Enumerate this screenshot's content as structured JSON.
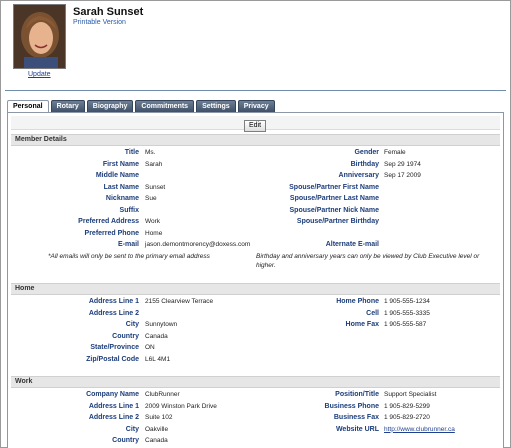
{
  "profile": {
    "name": "Sarah Sunset",
    "subtitle": "Printable Version",
    "update_label": "Update"
  },
  "tabs": [
    "Personal",
    "Rotary",
    "Biography",
    "Commitments",
    "Settings",
    "Privacy"
  ],
  "active_tab": "Personal",
  "toolbar": {
    "edit_label": "Edit"
  },
  "sections": {
    "member": "Member Details",
    "home": "Home",
    "work": "Work"
  },
  "member": {
    "left": [
      {
        "label": "Title",
        "value": "Ms."
      },
      {
        "label": "First Name",
        "value": "Sarah"
      },
      {
        "label": "Middle Name",
        "value": ""
      },
      {
        "label": "Last Name",
        "value": "Sunset"
      },
      {
        "label": "Nickname",
        "value": "Sue"
      },
      {
        "label": "Suffix",
        "value": ""
      },
      {
        "label": "Preferred Address",
        "value": "Work"
      },
      {
        "label": "Preferred Phone",
        "value": "Home"
      },
      {
        "label": "E-mail",
        "value": "jason.demontmorency@doxess.com"
      }
    ],
    "right": [
      {
        "label": "Gender",
        "value": "Female"
      },
      {
        "label": "Birthday",
        "value": "Sep 29 1974"
      },
      {
        "label": "Anniversary",
        "value": "Sep 17 2009"
      },
      {
        "label": "Spouse/Partner First Name",
        "value": ""
      },
      {
        "label": "Spouse/Partner Last Name",
        "value": ""
      },
      {
        "label": "Spouse/Partner Nick Name",
        "value": ""
      },
      {
        "label": "Spouse/Partner Birthday",
        "value": ""
      },
      {
        "label": "",
        "value": ""
      },
      {
        "label": "Alternate E-mail",
        "value": ""
      }
    ],
    "note_left": "*All emails will only be sent to the primary email address",
    "note_right": "Birthday and anniversary years can only be viewed by Club Executive level or higher."
  },
  "home": {
    "left": [
      {
        "label": "Address Line 1",
        "value": "2155 Clearview Terrace"
      },
      {
        "label": "Address Line 2",
        "value": ""
      },
      {
        "label": "City",
        "value": "Sunnytown"
      },
      {
        "label": "Country",
        "value": "Canada"
      },
      {
        "label": "State/Province",
        "value": "ON"
      },
      {
        "label": "Zip/Postal Code",
        "value": "L6L 4M1"
      }
    ],
    "right": [
      {
        "label": "Home Phone",
        "value": "1 905-555-1234"
      },
      {
        "label": "Cell",
        "value": "1 905-555-3335"
      },
      {
        "label": "Home Fax",
        "value": "1 905-555-587"
      }
    ]
  },
  "work": {
    "left": [
      {
        "label": "Company Name",
        "value": "ClubRunner"
      },
      {
        "label": "Address Line 1",
        "value": "2009 Winston Park Drive"
      },
      {
        "label": "Address Line 2",
        "value": "Suite 102"
      },
      {
        "label": "City",
        "value": "Oakville"
      },
      {
        "label": "Country",
        "value": "Canada"
      }
    ],
    "right": [
      {
        "label": "Position/Title",
        "value": "Support Specialist"
      },
      {
        "label": "Business Phone",
        "value": "1 905-829-5299"
      },
      {
        "label": "Business Fax",
        "value": "1 905-829-2720"
      },
      {
        "label": "Website URL",
        "value": "http://www.clubrunner.ca"
      }
    ]
  }
}
